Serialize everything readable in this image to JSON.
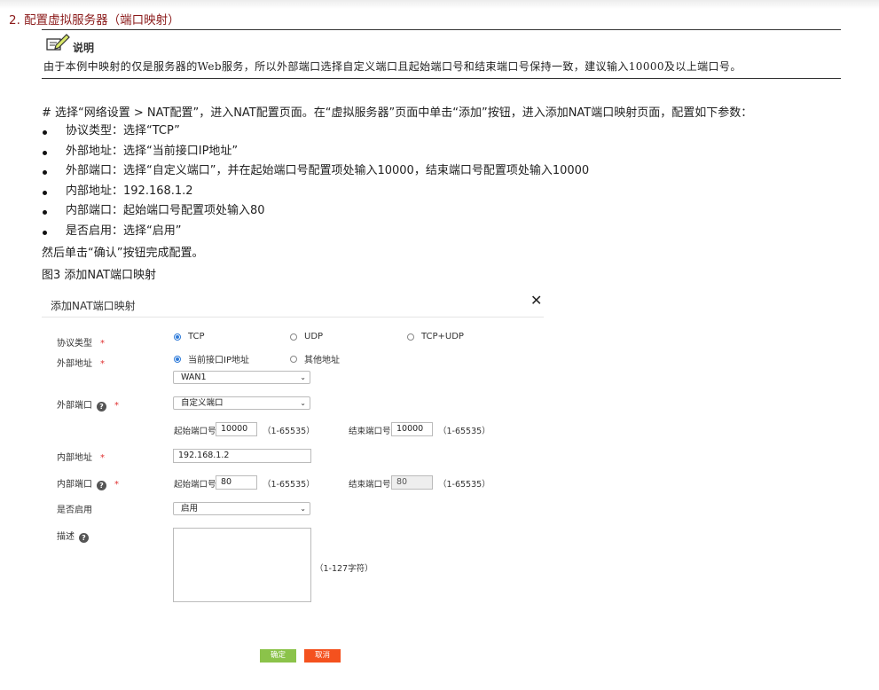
{
  "section_title": "2. 配置虚拟服务器（端口映射）",
  "note": {
    "label": "说明",
    "text": "由于本例中映射的仅是服务器的Web服务，所以外部端口选择自定义端口且起始端口号和结束端口号保持一致，建议输入10000及以上端口号。"
  },
  "step": "# 选择“网络设置 > NAT配置”，进入NAT配置页面。在“虚拟服务器”页面中单击“添加”按钮，进入添加NAT端口映射页面，配置如下参数：",
  "bullets": [
    "协议类型：选择“TCP”",
    "外部地址：选择“当前接口IP地址”",
    "外部端口：选择“自定义端口”，并在起始端口号配置项处输入10000，结束端口号配置项处输入10000",
    "内部地址：192.168.1.2",
    "内部端口：起始端口号配置项处输入80",
    "是否启用：选择“启用”"
  ],
  "after_text": "然后单击“确认”按钮完成配置。",
  "figure_caption": "图3 添加NAT端口映射",
  "dialog": {
    "title": "添加NAT端口映射",
    "close": "✕",
    "labels": {
      "protocol": "协议类型",
      "ext_addr": "外部地址",
      "ext_port": "外部端口",
      "int_addr": "内部地址",
      "int_port": "内部端口",
      "enable": "是否启用",
      "desc": "描述"
    },
    "required_mark": "*",
    "help_mark": "?",
    "protocol_options": [
      "TCP",
      "UDP",
      "TCP+UDP"
    ],
    "ext_addr_options": [
      "当前接口IP地址",
      "其他地址"
    ],
    "interface_select": "WAN1",
    "ext_port_select": "自定义端口",
    "start_port_label": "起始端口号",
    "end_port_label": "结束端口号",
    "range_hint": "（1-65535）",
    "ext_start_port": "10000",
    "ext_end_port": "10000",
    "int_address": "192.168.1.2",
    "int_start_port": "80",
    "int_end_port": "80",
    "enable_select": "启用",
    "desc_hint": "（1-127字符）",
    "ok_button": "确定",
    "cancel_button": "取消"
  },
  "colors": {
    "section_title": "#8b1a1a",
    "required": "#e03131",
    "radio_selected": "#2f7bd9",
    "ok_button": "#8bc34a",
    "cancel_button": "#f4511e"
  }
}
